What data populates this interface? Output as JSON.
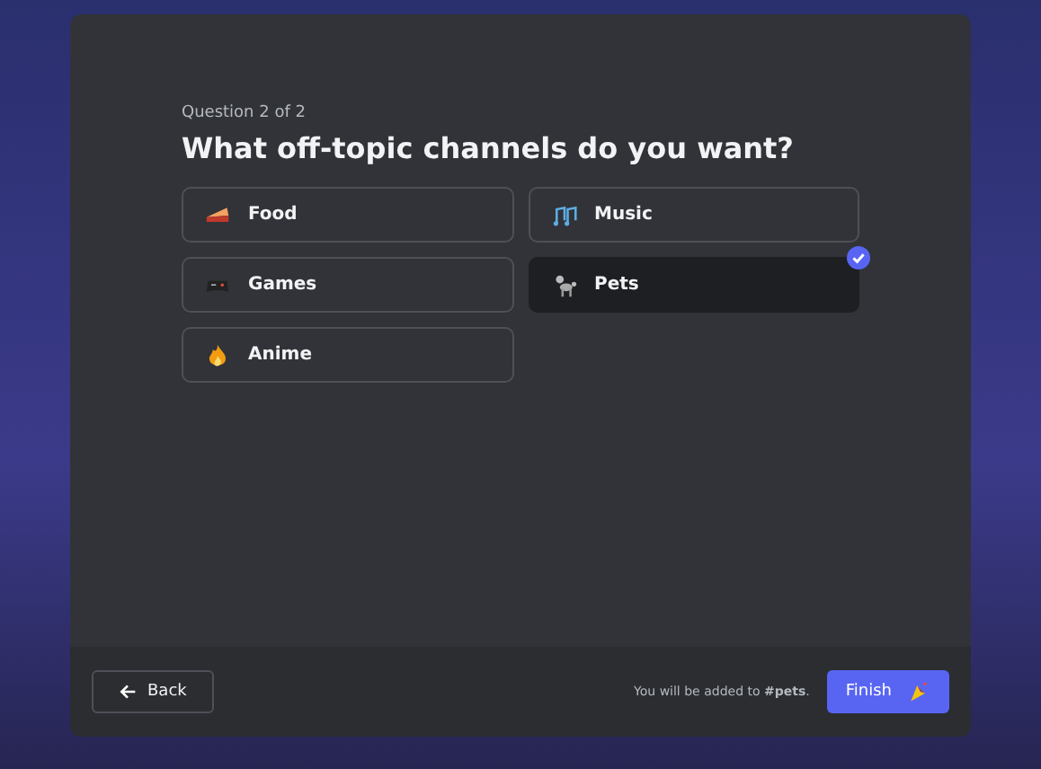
{
  "progress": "Question 2 of 2",
  "question": "What off-topic channels do you want?",
  "options": [
    {
      "label": "Food",
      "selected": false
    },
    {
      "label": "Music",
      "selected": false
    },
    {
      "label": "Games",
      "selected": false
    },
    {
      "label": "Pets",
      "selected": true
    },
    {
      "label": "Anime",
      "selected": false
    }
  ],
  "footer": {
    "back": "Back",
    "note": "You will be added to **#pets**.",
    "finish": "Finish"
  }
}
